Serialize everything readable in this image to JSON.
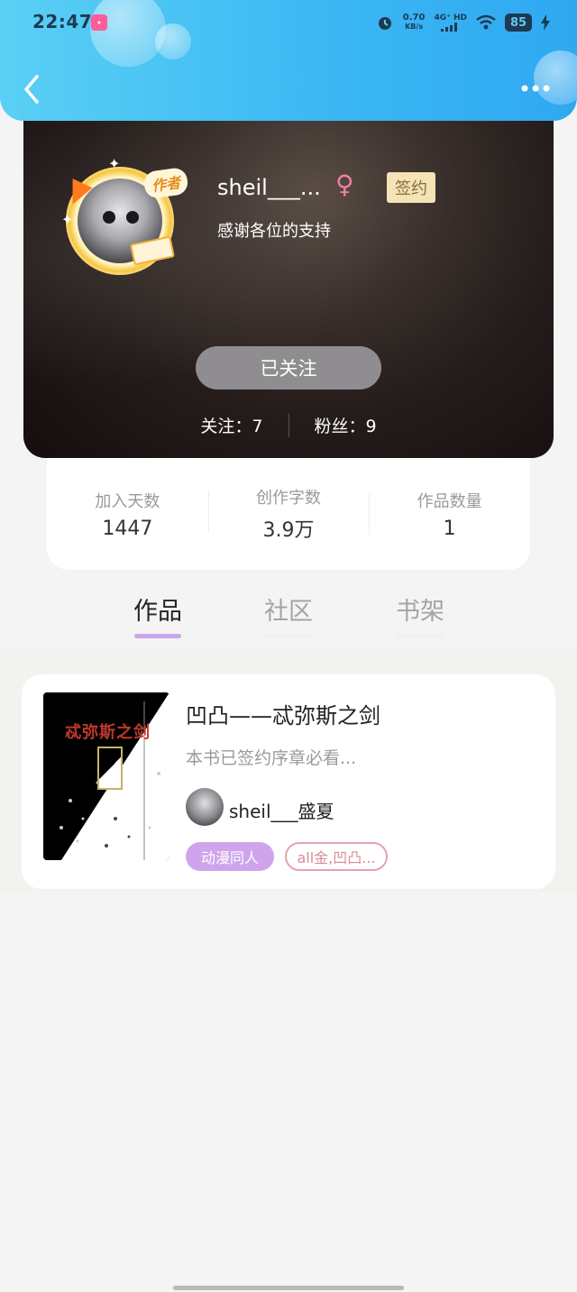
{
  "status_bar": {
    "time": "22:47",
    "speed_value": "0.70",
    "speed_unit": "KB/s",
    "network": "4G⁺ HD",
    "battery": "85"
  },
  "profile": {
    "author_tag": "作者",
    "username": "sheil___...",
    "gender_symbol": "♀",
    "signed_label": "签约",
    "bio": "感谢各位的支持",
    "follow_button": "已关注",
    "following": "关注：7",
    "fans": "粉丝：9"
  },
  "stats": [
    {
      "label": "加入天数",
      "value": "1447"
    },
    {
      "label": "创作字数",
      "value": "3.9万"
    },
    {
      "label": "作品数量",
      "value": "1"
    }
  ],
  "tabs": [
    {
      "label": "作品",
      "active": true
    },
    {
      "label": "社区",
      "active": false
    },
    {
      "label": "书架",
      "active": false
    }
  ],
  "works": [
    {
      "cover_title": "忒弥斯之剑",
      "title": "凹凸——忒弥斯之剑",
      "desc": "本书已签约序章必看...",
      "author": "sheil___盛夏",
      "tags": [
        "动漫同人",
        "all金,凹凸..."
      ]
    }
  ],
  "colors": {
    "header": "#3ab6f3",
    "tab_indicator": "#c8a6ec",
    "tag_primary": "#cfa4ed",
    "tag_outline": "#e3a4ad",
    "gender": "#f07e9f"
  }
}
